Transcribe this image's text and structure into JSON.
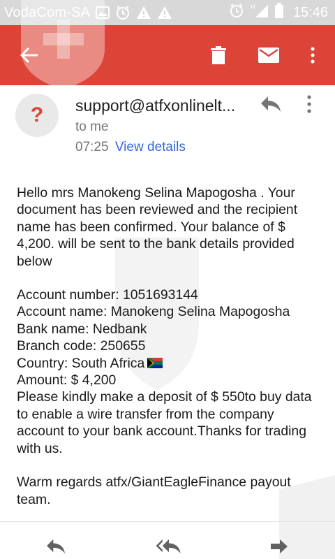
{
  "status": {
    "carrier": "VodaCom-SA",
    "time": "15:46"
  },
  "toolbar": {
    "back": "arrow-back-icon",
    "delete": "trash-icon",
    "mail": "mail-icon",
    "more": "more-vert-icon"
  },
  "email": {
    "avatar_text": "?",
    "sender": "support@atfxonlinelt...",
    "to_me": "to me",
    "time": "07:25",
    "view_details": "View details",
    "body": {
      "intro": "Hello mrs Manokeng Selina Mapogosha . Your document has been reviewed and the recipient name has been confirmed. Your balance of $ 4,200. will be sent to the bank details provided below",
      "account_number": "Account number: 1051693144",
      "account_name": "Account name: Manokeng Selina Mapogosha",
      "bank_name": "Bank name: Nedbank",
      "branch_code": "Branch code: 250655",
      "country": "Country: South Africa",
      "amount": "Amount: $ 4,200",
      "request": "Please kindly make a deposit of $ 550to buy data to enable a wire transfer from the company account to your bank account.Thanks for trading with us.",
      "signoff": "Warm regards atfx/GiantEagleFinance payout team."
    }
  },
  "colors": {
    "toolbar": "#db4437",
    "link": "#3367d6",
    "statusbar": "#d8d8d8"
  }
}
